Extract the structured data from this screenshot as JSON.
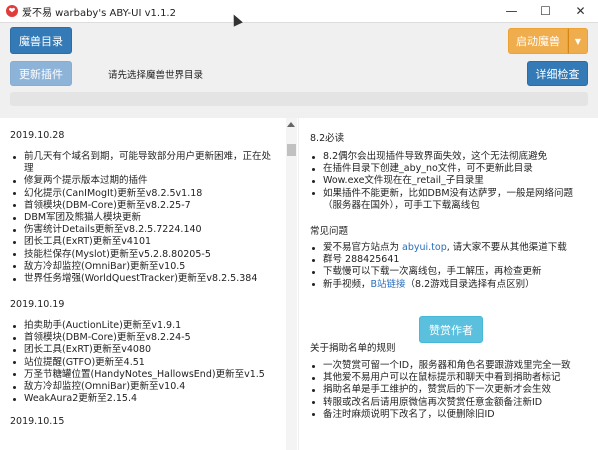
{
  "window": {
    "title": "爱不易 warbaby's ABY-UI v1.1.2",
    "app_icon": "heart-icon",
    "controls": {
      "minimize": "—",
      "maximize": "☐",
      "close": "✕"
    }
  },
  "toolbar": {
    "dir_button": "魔兽目录",
    "update_button": "更新插件",
    "status_text": "请先选择魔兽世界目录",
    "launch_button": "启动魔兽",
    "launch_caret": "▼",
    "check_button": "详细检查",
    "progress": 0
  },
  "changelog": [
    {
      "date": "2019.10.28",
      "items": [
        "前几天有个域名到期，可能导致部分用户更新困难，正在处理",
        "修复两个提示版本过期的插件",
        "幻化提示(CanIMogIt)更新至v8.2.5v1.18",
        "首领模块(DBM-Core)更新至v8.2.25-7",
        "DBM军团及熊猫人模块更新",
        "伤害统计Details更新至v8.2.5.7224.140",
        "团长工具(ExRT)更新至v4101",
        "技能栏保存(Myslot)更新至v5.2.8.80205-5",
        "敌方冷却监控(OmniBar)更新至v10.5",
        "世界任务增强(WorldQuestTracker)更新至v8.2.5.384"
      ]
    },
    {
      "date": "2019.10.19",
      "items": [
        "拍卖助手(AuctionLite)更新至v1.9.1",
        "首领模块(DBM-Core)更新至v8.2.24-5",
        "团长工具(ExRT)更新至v4080",
        "站位提醒(GTFO)更新至4.51",
        "万圣节糖罐位置(HandyNotes_HallowsEnd)更新至v1.5",
        "敌方冷却监控(OmniBar)更新至v10.4",
        "WeakAura2更新至2.15.4"
      ]
    },
    {
      "date": "2019.10.15",
      "items": []
    }
  ],
  "notice": {
    "section1_title": "8.2必读",
    "section1_items": [
      "8.2偶尔会出现插件导致界面失效，这个无法彻底避免",
      "在插件目录下创建_aby_no文件，可不更新此目录",
      "Wow.exe文件现在在_retail_子目录里",
      "如果插件不能更新，比如DBM没有达萨罗，一般是网络问题（服务器在国外），可手工下载离线包"
    ],
    "section2_title": "常见问题",
    "official_site": {
      "prefix": "爱不易官方站点为 ",
      "link": "abyui.top",
      "suffix": ", 请大家不要从其他渠道下载"
    },
    "group": "群号 288425641",
    "offline_tip": "下载慢可以下载一次离线包，手工解压，再检查更新",
    "video": {
      "prefix": "新手视频，",
      "link": "B站链接",
      "suffix": "（8.2游戏目录选择有点区别）"
    },
    "donate_button": "赞赏作者",
    "section3_title": "关于捐助名单的规则",
    "section3_items": [
      "一次赞赏可留一个ID，服务器和角色名要跟游戏里完全一致",
      "其他爱不易用户可以在鼠标提示和聊天中看到捐助者标记",
      "捐助名单是手工维护的，赞赏后的下一次更新才会生效",
      "转服或改名后请用原微信再次赞赏任意金额备注新ID",
      "备注时麻烦说明下改名了，以便删除旧ID"
    ]
  },
  "colors": {
    "primary": "#337ab7",
    "warning": "#f0ad4e",
    "info": "#5bc0de",
    "danger_text": "#d9191e",
    "link": "#2a6ebb"
  }
}
